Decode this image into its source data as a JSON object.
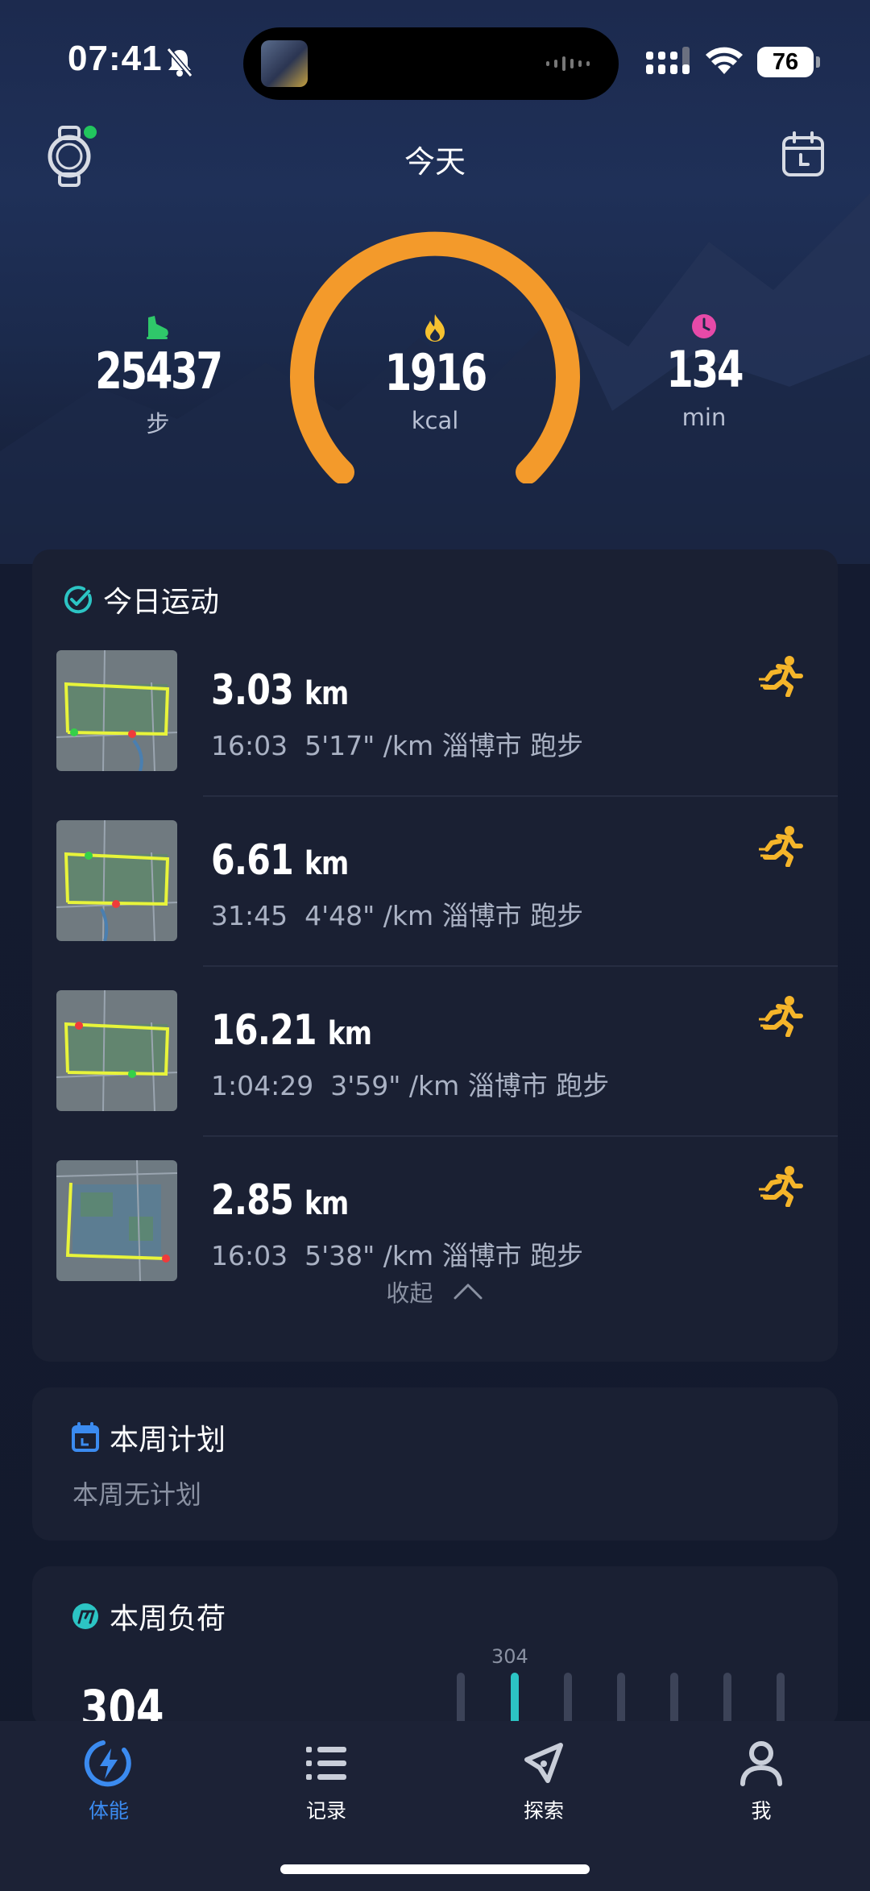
{
  "status_bar": {
    "time": "07:41",
    "battery": "76"
  },
  "header": {
    "title": "今天"
  },
  "summary": {
    "steps": {
      "value": "25437",
      "unit": "步"
    },
    "calories": {
      "value": "1916",
      "unit": "kcal",
      "progress": 0.75
    },
    "minutes": {
      "value": "134",
      "unit": "min"
    }
  },
  "today_card": {
    "title": "今日运动",
    "activities": [
      {
        "distance": "3.03",
        "unit": "km",
        "meta": "16:03  5'17\" /km 淄博市 跑步"
      },
      {
        "distance": "6.61",
        "unit": "km",
        "meta": "31:45  4'48\" /km 淄博市 跑步"
      },
      {
        "distance": "16.21",
        "unit": "km",
        "meta": "1:04:29  3'59\" /km 淄博市 跑步"
      },
      {
        "distance": "2.85",
        "unit": "km",
        "meta": "16:03  5'38\" /km 淄博市 跑步"
      }
    ],
    "collapse_label": "收起"
  },
  "plan_card": {
    "title": "本周计划",
    "empty_text": "本周无计划"
  },
  "load_card": {
    "title": "本周负荷",
    "value": "304",
    "bar_label": "304"
  },
  "tabs": [
    {
      "label": "体能",
      "icon": "bolt-icon",
      "active": true
    },
    {
      "label": "记录",
      "icon": "list-icon",
      "active": false
    },
    {
      "label": "探索",
      "icon": "compass-icon",
      "active": false
    },
    {
      "label": "我",
      "icon": "person-icon",
      "active": false
    }
  ],
  "colors": {
    "accent": "#3b8bf0",
    "calorie_ring": "#f39a2b",
    "route": "#e8f43a",
    "run_icon": "#f5b52a",
    "teal": "#2cc4c4"
  }
}
